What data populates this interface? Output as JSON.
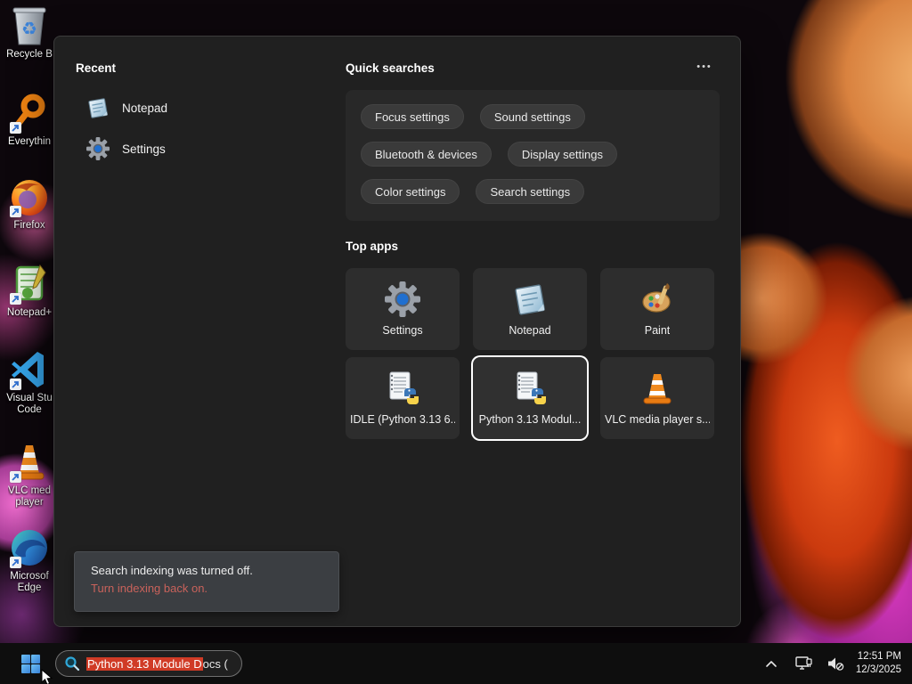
{
  "desktop": {
    "icons": [
      {
        "label_lines": [
          "Recycle B"
        ]
      },
      {
        "label_lines": [
          "Everythin"
        ]
      },
      {
        "label_lines": [
          "Firefox"
        ]
      },
      {
        "label_lines": [
          "Notepad+"
        ]
      },
      {
        "label_lines": [
          "Visual Stu",
          "Code"
        ]
      },
      {
        "label_lines": [
          "VLC med",
          "player"
        ]
      },
      {
        "label_lines": [
          "Microsof",
          "Edge"
        ]
      }
    ]
  },
  "search_panel": {
    "recent": {
      "title": "Recent",
      "items": [
        {
          "label": "Notepad"
        },
        {
          "label": "Settings"
        }
      ]
    },
    "quick_searches": {
      "title": "Quick searches",
      "more_label": "•••",
      "pills": [
        "Focus settings",
        "Sound settings",
        "Bluetooth & devices",
        "Display settings",
        "Color settings",
        "Search settings"
      ]
    },
    "top_apps": {
      "title": "Top apps",
      "tiles": [
        {
          "label": "Settings"
        },
        {
          "label": "Notepad"
        },
        {
          "label": "Paint"
        },
        {
          "label": "IDLE (Python 3.13 6..."
        },
        {
          "label": "Python 3.13 Modul...",
          "selected": true
        },
        {
          "label": "VLC media player s..."
        }
      ]
    },
    "indexing_tooltip": {
      "message": "Search indexing was turned off.",
      "link": "Turn indexing back on."
    }
  },
  "taskbar": {
    "search": {
      "selected_text": "Python 3.13 Module D",
      "unselected_text": "ocs ("
    },
    "tray": {
      "time": "12:51 PM",
      "date": "12/3/2025"
    }
  },
  "colors": {
    "selection_red": "#d03b26",
    "indexing_link": "#c9625b",
    "selected_tile_border": "#ffffff",
    "panel_bg": "#202020"
  }
}
